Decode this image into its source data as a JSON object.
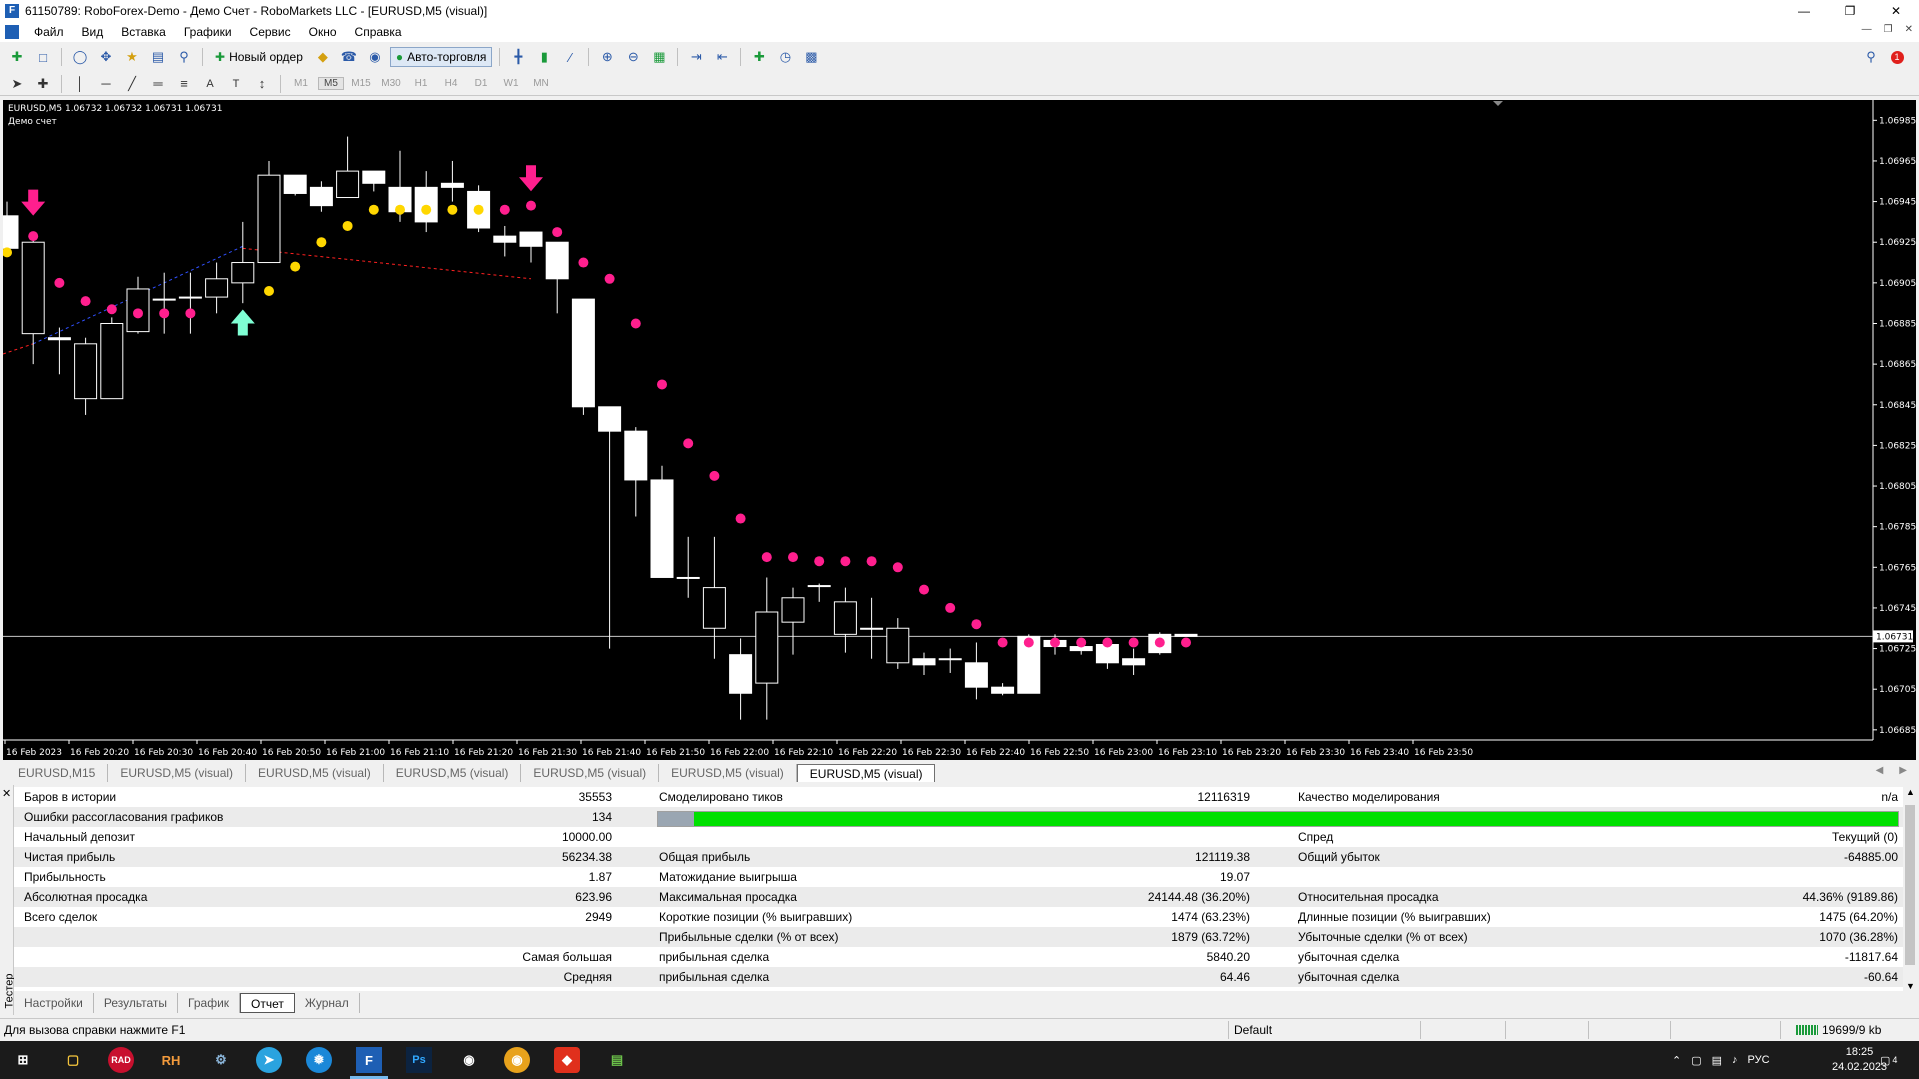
{
  "window": {
    "title": "61150789: RoboForex-Demo - Демо Счет - RoboMarkets LLC - [EURUSD,M5 (visual)]",
    "app_icon": "terminal-icon"
  },
  "menu": [
    "Файл",
    "Вид",
    "Вставка",
    "Графики",
    "Сервис",
    "Окно",
    "Справка"
  ],
  "toolbar": {
    "new_order_label": "Новый ордер",
    "autotrading_label": "Авто-торговля",
    "timeframes": [
      "M1",
      "M5",
      "M15",
      "M30",
      "H1",
      "H4",
      "D1",
      "W1",
      "MN"
    ],
    "active_timeframe": "M5",
    "alert_count": "1"
  },
  "chart": {
    "symbol_info": "EURUSD,M5  1.06732 1.06732 1.06731 1.06731",
    "account_label": "Демо счет",
    "current_price_label": "1.06731",
    "price_ticks": [
      "1.06985",
      "1.06965",
      "1.06945",
      "1.06925",
      "1.06905",
      "1.06885",
      "1.06865",
      "1.06845",
      "1.06825",
      "1.06805",
      "1.06785",
      "1.06765",
      "1.06745",
      "1.06725",
      "1.06705",
      "1.06685"
    ],
    "time_ticks": [
      "16 Feb 2023",
      "16 Feb 20:20",
      "16 Feb 20:30",
      "16 Feb 20:40",
      "16 Feb 20:50",
      "16 Feb 21:00",
      "16 Feb 21:10",
      "16 Feb 21:20",
      "16 Feb 21:30",
      "16 Feb 21:40",
      "16 Feb 21:50",
      "16 Feb 22:00",
      "16 Feb 22:10",
      "16 Feb 22:20",
      "16 Feb 22:30",
      "16 Feb 22:40",
      "16 Feb 22:50",
      "16 Feb 23:00",
      "16 Feb 23:10",
      "16 Feb 23:20",
      "16 Feb 23:30",
      "16 Feb 23:40",
      "16 Feb 23:50"
    ],
    "colors": {
      "background": "#000000",
      "candle": "#ffffff",
      "sar_up": "#ffd700",
      "sar_down": "#ff1f8e",
      "buy_arrow": "#7fffd4",
      "sell_arrow": "#ff1f8e"
    },
    "chart_data": {
      "type": "candlestick",
      "symbol": "EURUSD",
      "timeframe": "M5",
      "ylim": [
        1.0668,
        1.06995
      ],
      "current_price": 1.06731,
      "candles": [
        [
          1.06938,
          1.06945,
          1.06918,
          1.06922
        ],
        [
          1.0688,
          1.0693,
          1.06865,
          1.06925
        ],
        [
          1.06878,
          1.06883,
          1.0686,
          1.06877
        ],
        [
          1.06848,
          1.06878,
          1.0684,
          1.06875
        ],
        [
          1.06848,
          1.06888,
          1.06848,
          1.06885
        ],
        [
          1.06881,
          1.06908,
          1.0688,
          1.06902
        ],
        [
          1.06897,
          1.0691,
          1.0688,
          1.06897
        ],
        [
          1.06898,
          1.0691,
          1.0688,
          1.06898
        ],
        [
          1.06898,
          1.06915,
          1.0689,
          1.06907
        ],
        [
          1.06905,
          1.06935,
          1.06895,
          1.06915
        ],
        [
          1.06915,
          1.06965,
          1.06915,
          1.06958
        ],
        [
          1.06958,
          1.06958,
          1.06948,
          1.06949
        ],
        [
          1.06952,
          1.06955,
          1.0694,
          1.06943
        ],
        [
          1.06947,
          1.06977,
          1.06947,
          1.0696
        ],
        [
          1.0696,
          1.0696,
          1.0695,
          1.06954
        ],
        [
          1.06952,
          1.0697,
          1.06935,
          1.0694
        ],
        [
          1.06952,
          1.0696,
          1.0693,
          1.06935
        ],
        [
          1.06954,
          1.06965,
          1.06945,
          1.06952
        ],
        [
          1.0695,
          1.06953,
          1.0693,
          1.06932
        ],
        [
          1.06928,
          1.06933,
          1.06918,
          1.06925
        ],
        [
          1.0693,
          1.0693,
          1.06915,
          1.06923
        ],
        [
          1.06925,
          1.06925,
          1.0689,
          1.06907
        ],
        [
          1.06897,
          1.06897,
          1.0684,
          1.06844
        ],
        [
          1.06844,
          1.06844,
          1.06725,
          1.06832
        ],
        [
          1.06832,
          1.06834,
          1.0679,
          1.06808
        ],
        [
          1.06808,
          1.06815,
          1.06762,
          1.0676
        ],
        [
          1.0676,
          1.0678,
          1.0675,
          1.0676
        ],
        [
          1.06735,
          1.0678,
          1.0672,
          1.06755
        ],
        [
          1.06722,
          1.0673,
          1.0669,
          1.06703
        ],
        [
          1.06708,
          1.0676,
          1.0669,
          1.06743
        ],
        [
          1.06738,
          1.06755,
          1.06722,
          1.0675
        ],
        [
          1.06756,
          1.06757,
          1.06748,
          1.06756
        ],
        [
          1.06732,
          1.06755,
          1.06723,
          1.06748
        ],
        [
          1.06735,
          1.0675,
          1.0672,
          1.06735
        ],
        [
          1.06718,
          1.0674,
          1.06715,
          1.06735
        ],
        [
          1.0672,
          1.06723,
          1.06712,
          1.06717
        ],
        [
          1.0672,
          1.06725,
          1.06713,
          1.0672
        ],
        [
          1.06718,
          1.06728,
          1.067,
          1.06706
        ],
        [
          1.06706,
          1.06708,
          1.06702,
          1.06703
        ],
        [
          1.06731,
          1.06732,
          1.06705,
          1.06703
        ],
        [
          1.06729,
          1.06732,
          1.06722,
          1.06726
        ],
        [
          1.06726,
          1.06729,
          1.06722,
          1.06724
        ],
        [
          1.06727,
          1.0673,
          1.06715,
          1.06718
        ],
        [
          1.0672,
          1.06725,
          1.06712,
          1.06717
        ],
        [
          1.06732,
          1.06733,
          1.06722,
          1.06723
        ],
        [
          1.06732,
          1.06732,
          1.06731,
          1.06731
        ]
      ],
      "sar_up": [
        [
          0,
          1.0692
        ],
        [
          10,
          1.06901
        ],
        [
          11,
          1.06913
        ],
        [
          12,
          1.06925
        ],
        [
          13,
          1.06933
        ],
        [
          14,
          1.06941
        ],
        [
          15,
          1.06941
        ],
        [
          16,
          1.06941
        ],
        [
          17,
          1.06941
        ],
        [
          18,
          1.06941
        ]
      ],
      "sar_down": [
        [
          1,
          1.06928
        ],
        [
          2,
          1.06905
        ],
        [
          3,
          1.06896
        ],
        [
          4,
          1.06892
        ],
        [
          5,
          1.0689
        ],
        [
          6,
          1.0689
        ],
        [
          7,
          1.0689
        ],
        [
          19,
          1.06941
        ],
        [
          20,
          1.06943
        ],
        [
          21,
          1.0693
        ],
        [
          22,
          1.06915
        ],
        [
          23,
          1.06907
        ],
        [
          24,
          1.06885
        ],
        [
          25,
          1.06855
        ],
        [
          26,
          1.06826
        ],
        [
          27,
          1.0681
        ],
        [
          28,
          1.06789
        ],
        [
          29,
          1.0677
        ],
        [
          30,
          1.0677
        ],
        [
          31,
          1.06768
        ],
        [
          32,
          1.06768
        ],
        [
          33,
          1.06768
        ],
        [
          34,
          1.06765
        ],
        [
          35,
          1.06754
        ],
        [
          36,
          1.06745
        ],
        [
          37,
          1.06737
        ],
        [
          38,
          1.06728
        ],
        [
          39,
          1.06728
        ],
        [
          40,
          1.06728
        ],
        [
          41,
          1.06728
        ],
        [
          42,
          1.06728
        ],
        [
          43,
          1.06728
        ],
        [
          44,
          1.06728
        ],
        [
          45,
          1.06728
        ]
      ],
      "buy_arrows": [
        [
          9,
          1.06885
        ]
      ],
      "sell_arrows": [
        [
          1,
          1.06945
        ],
        [
          20,
          1.06957
        ]
      ]
    }
  },
  "chart_tabs": [
    "EURUSD,M15",
    "EURUSD,M5 (visual)",
    "EURUSD,M5 (visual)",
    "EURUSD,M5 (visual)",
    "EURUSD,M5 (visual)",
    "EURUSD,M5 (visual)",
    "EURUSD,M5 (visual)"
  ],
  "report": {
    "rows": [
      {
        "c1l": "Баров в истории",
        "c1v": "35553",
        "c2l": "Смоделировано тиков",
        "c2v": "12116319",
        "c3l": "Качество моделирования",
        "c3v": "n/a"
      },
      {
        "c1l": "Ошибки рассогласования графиков",
        "c1v": "134",
        "c2l": "",
        "c2v": "",
        "c3l": "",
        "c3v": ""
      },
      {
        "c1l": "Начальный депозит",
        "c1v": "10000.00",
        "c2l": "",
        "c2v": "",
        "c3l": "Спред",
        "c3v": "Текущий (0)"
      },
      {
        "c1l": "Чистая прибыль",
        "c1v": "56234.38",
        "c2l": "Общая прибыль",
        "c2v": "121119.38",
        "c3l": "Общий убыток",
        "c3v": "-64885.00"
      },
      {
        "c1l": "Прибыльность",
        "c1v": "1.87",
        "c2l": "Матожидание выигрыша",
        "c2v": "19.07",
        "c3l": "",
        "c3v": ""
      },
      {
        "c1l": "Абсолютная просадка",
        "c1v": "623.96",
        "c2l": "Максимальная просадка",
        "c2v": "24144.48 (36.20%)",
        "c3l": "Относительная просадка",
        "c3v": "44.36% (9189.86)"
      },
      {
        "c1l": "Всего сделок",
        "c1v": "2949",
        "c2l": "Короткие позиции (% выигравших)",
        "c2v": "1474 (63.23%)",
        "c3l": "Длинные позиции (% выигравших)",
        "c3v": "1475 (64.20%)"
      },
      {
        "c1l": "",
        "c1v": "",
        "c2l": "Прибыльные сделки (% от всех)",
        "c2v": "1879 (63.72%)",
        "c3l": "Убыточные сделки (% от всех)",
        "c3v": "1070 (36.28%)"
      },
      {
        "c1l": "",
        "c1v": "Самая большая",
        "c2l": "прибыльная сделка",
        "c2v": "5840.20",
        "c3l": "убыточная сделка",
        "c3v": "-11817.64"
      },
      {
        "c1l": "",
        "c1v": "Средняя",
        "c2l": "прибыльная сделка",
        "c2v": "64.46",
        "c3l": "убыточная сделка",
        "c3v": "-60.64"
      }
    ],
    "progress_fraction": 1.0
  },
  "tester": {
    "side_label": "Тестер",
    "tabs": [
      "Настройки",
      "Результаты",
      "График",
      "Отчет",
      "Журнал"
    ],
    "active_tab": "Отчет"
  },
  "status": {
    "help": "Для вызова справки нажмите F1",
    "profile": "Default",
    "traffic": "19699/9 kb"
  },
  "taskbar": {
    "time": "18:25",
    "date": "24.02.2023",
    "lang": "РУС",
    "notif_count": "4"
  }
}
